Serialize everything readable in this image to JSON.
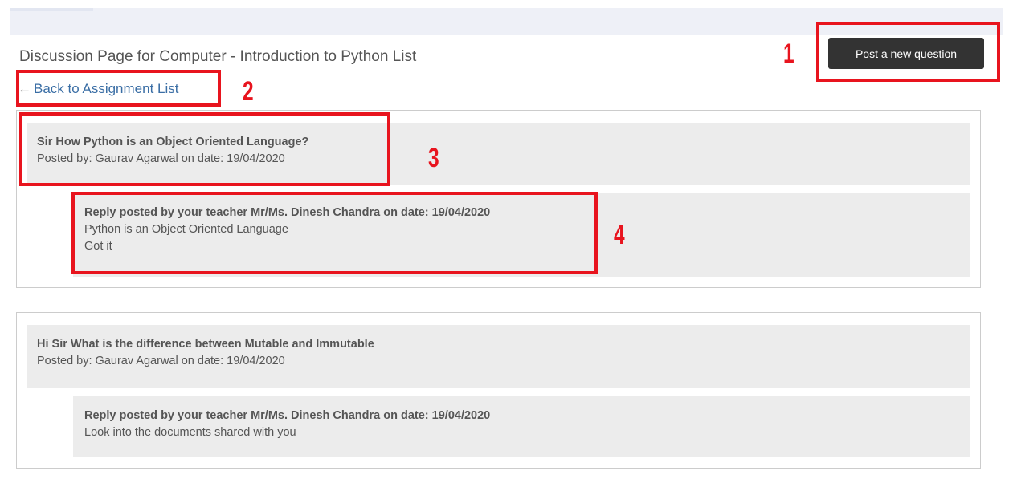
{
  "header": {
    "title": "Discussion Page for Computer - Introduction to Python List",
    "post_button_label": "Post a new question",
    "back_link_arrow": "←",
    "back_link_label": "Back to Assignment List"
  },
  "threads": [
    {
      "question_title": "Sir How Python is an Object Oriented Language?",
      "question_meta": "Posted by: Gaurav Agarwal on date: 19/04/2020",
      "reply_title": "Reply posted by your teacher Mr/Ms. Dinesh Chandra on date: 19/04/2020",
      "reply_lines": [
        "Python is an Object Oriented Language",
        "Got it"
      ]
    },
    {
      "question_title": "Hi Sir What is the difference between Mutable and Immutable",
      "question_meta": "Posted by: Gaurav Agarwal on date: 19/04/2020",
      "reply_title": "Reply posted by your teacher Mr/Ms. Dinesh Chandra on date: 19/04/2020",
      "reply_lines": [
        "Look into the documents shared with you"
      ]
    }
  ],
  "annotations": [
    "1",
    "2",
    "3",
    "4"
  ],
  "colors": {
    "annotation": "#e8141e",
    "button_bg": "#333333",
    "link": "#3a6ea5",
    "panel_bg": "#ececec"
  }
}
